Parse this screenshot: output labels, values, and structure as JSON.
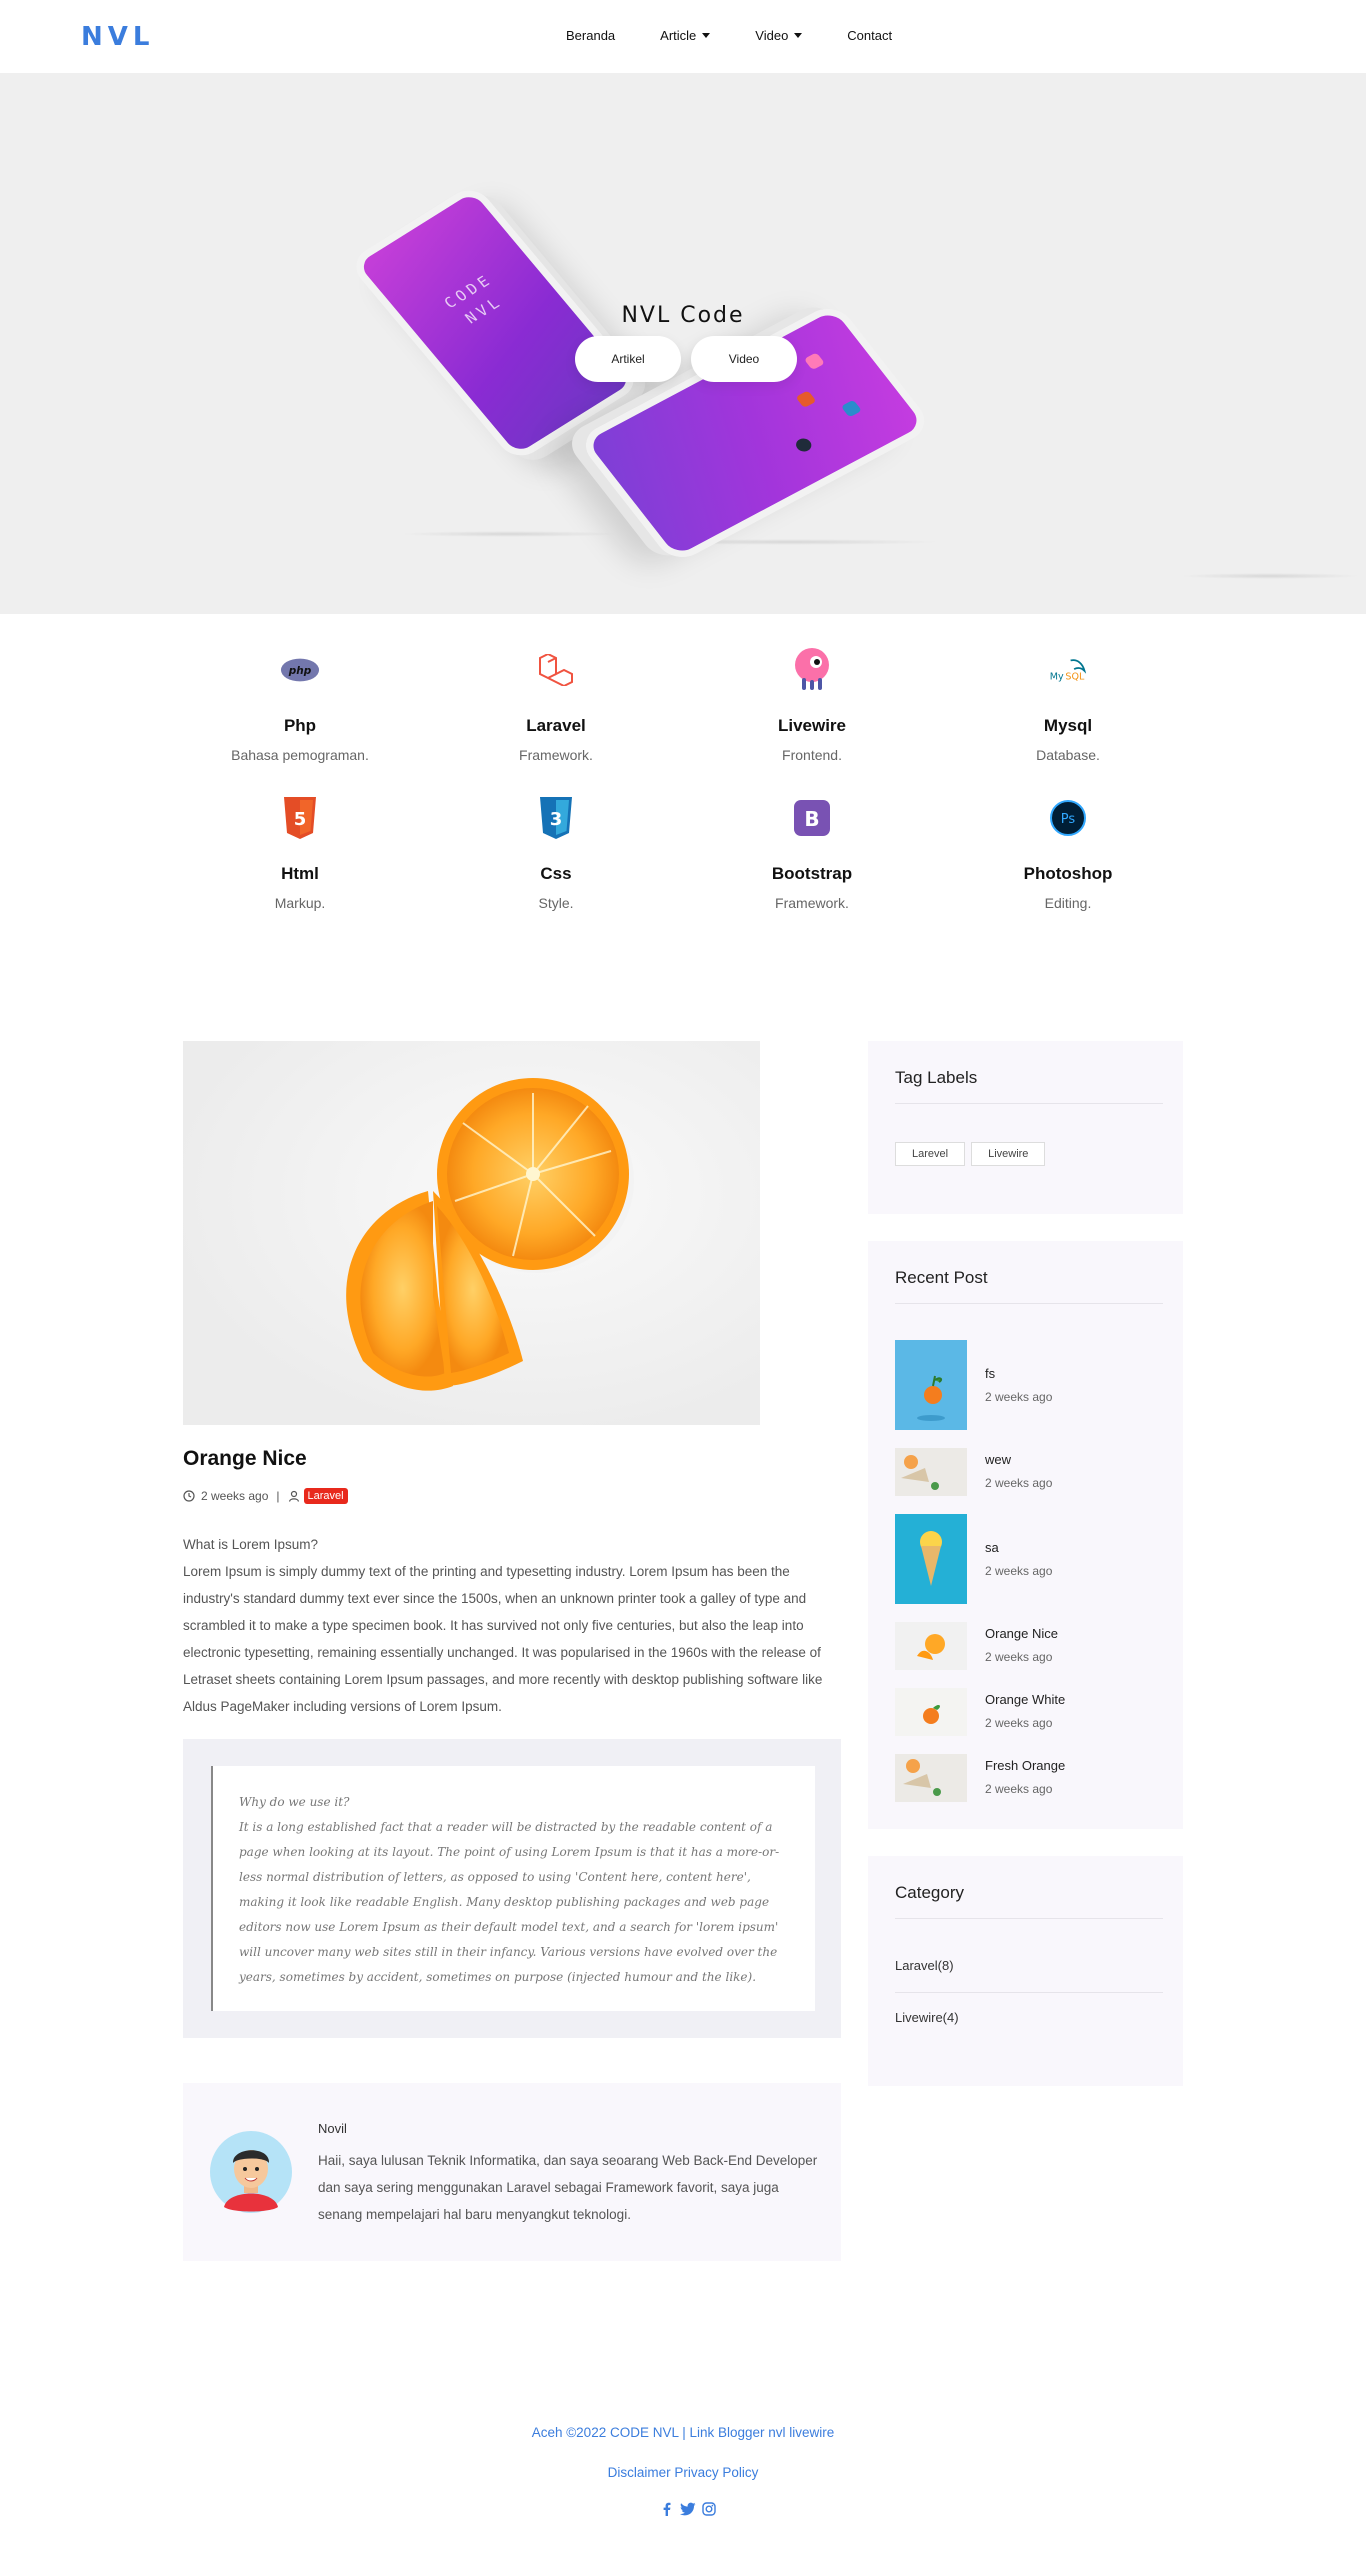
{
  "nav": {
    "logo": "NVL",
    "items": [
      {
        "label": "Beranda",
        "dropdown": false
      },
      {
        "label": "Article",
        "dropdown": true
      },
      {
        "label": "Video",
        "dropdown": true
      },
      {
        "label": "Contact",
        "dropdown": false
      }
    ]
  },
  "hero": {
    "title": "NVL Code",
    "phone_text_1": "CODE",
    "phone_text_2": "NVL",
    "buttons": [
      "Artikel",
      "Video"
    ]
  },
  "skills": [
    {
      "name": "Php",
      "desc": "Bahasa pemograman.",
      "icon": "php-icon",
      "color": "#7377ad"
    },
    {
      "name": "Laravel",
      "desc": "Framework.",
      "icon": "laravel-icon",
      "color": "#f05340"
    },
    {
      "name": "Livewire",
      "desc": "Frontend.",
      "icon": "livewire-icon",
      "color": "#fb70a9"
    },
    {
      "name": "Mysql",
      "desc": "Database.",
      "icon": "mysql-icon",
      "color": "#00758f"
    },
    {
      "name": "Html",
      "desc": "Markup.",
      "icon": "html5-icon",
      "color": "#e44d26"
    },
    {
      "name": "Css",
      "desc": "Style.",
      "icon": "css3-icon",
      "color": "#1572b6"
    },
    {
      "name": "Bootstrap",
      "desc": "Framework.",
      "icon": "bootstrap-icon",
      "color": "#7952b3"
    },
    {
      "name": "Photoshop",
      "desc": "Editing.",
      "icon": "photoshop-icon",
      "color": "#31a8ff"
    }
  ],
  "post": {
    "title": "Orange Nice",
    "time": "2 weeks ago",
    "separator": "|",
    "tag": "Laravel",
    "heading": "What is Lorem Ipsum?",
    "body": "Lorem Ipsum is simply dummy text of the printing and typesetting industry. Lorem Ipsum has been the industry's standard dummy text ever since the 1500s, when an unknown printer took a galley of type and scrambled it to make a type specimen book. It has survived not only five centuries, but also the leap into electronic typesetting, remaining essentially unchanged. It was popularised in the 1960s with the release of Letraset sheets containing Lorem Ipsum passages, and more recently with desktop publishing software like Aldus PageMaker including versions of Lorem Ipsum.",
    "quote_heading": "Why do we use it?",
    "quote_body": "It is a long established fact that a reader will be distracted by the readable content of a page when looking at its layout. The point of using Lorem Ipsum is that it has a more-or-less normal distribution of letters, as opposed to using 'Content here, content here', making it look like readable English. Many desktop publishing packages and web page editors now use Lorem Ipsum as their default model text, and a search for 'lorem ipsum' will uncover many web sites still in their infancy. Various versions have evolved over the years, sometimes by accident, sometimes on purpose (injected humour and the like)."
  },
  "author": {
    "name": "Novil",
    "bio": "Haii, saya lulusan Teknik Informatika, dan saya seoarang Web Back-End Developer dan saya sering menggunakan Laravel sebagai Framework favorit, saya juga senang mempelajari hal baru menyangkut teknologi."
  },
  "sidebar": {
    "tags_title": "Tag Labels",
    "tags": [
      "Larevel",
      "Livewire"
    ],
    "recent_title": "Recent Post",
    "recent": [
      {
        "title": "fs",
        "time": "2 weeks ago"
      },
      {
        "title": "wew",
        "time": "2 weeks ago"
      },
      {
        "title": "sa",
        "time": "2 weeks ago"
      },
      {
        "title": "Orange Nice",
        "time": "2 weeks ago"
      },
      {
        "title": "Orange White",
        "time": "2 weeks ago"
      },
      {
        "title": "Fresh Orange",
        "time": "2 weeks ago"
      }
    ],
    "category_title": "Category",
    "categories": [
      "Laravel(8)",
      "Livewire(4)"
    ]
  },
  "footer": {
    "line1": "Aceh ©2022 CODE NVL | Link Blogger nvl livewire",
    "line2": "Disclaimer Privacy Policy",
    "social_icons": [
      "facebook-icon",
      "twitter-icon",
      "instagram-icon"
    ]
  },
  "colors": {
    "accent": "#3b7ddd",
    "badge": "#e8291c",
    "hero_bg": "#efefef",
    "card_bg": "#f9f7fc"
  }
}
